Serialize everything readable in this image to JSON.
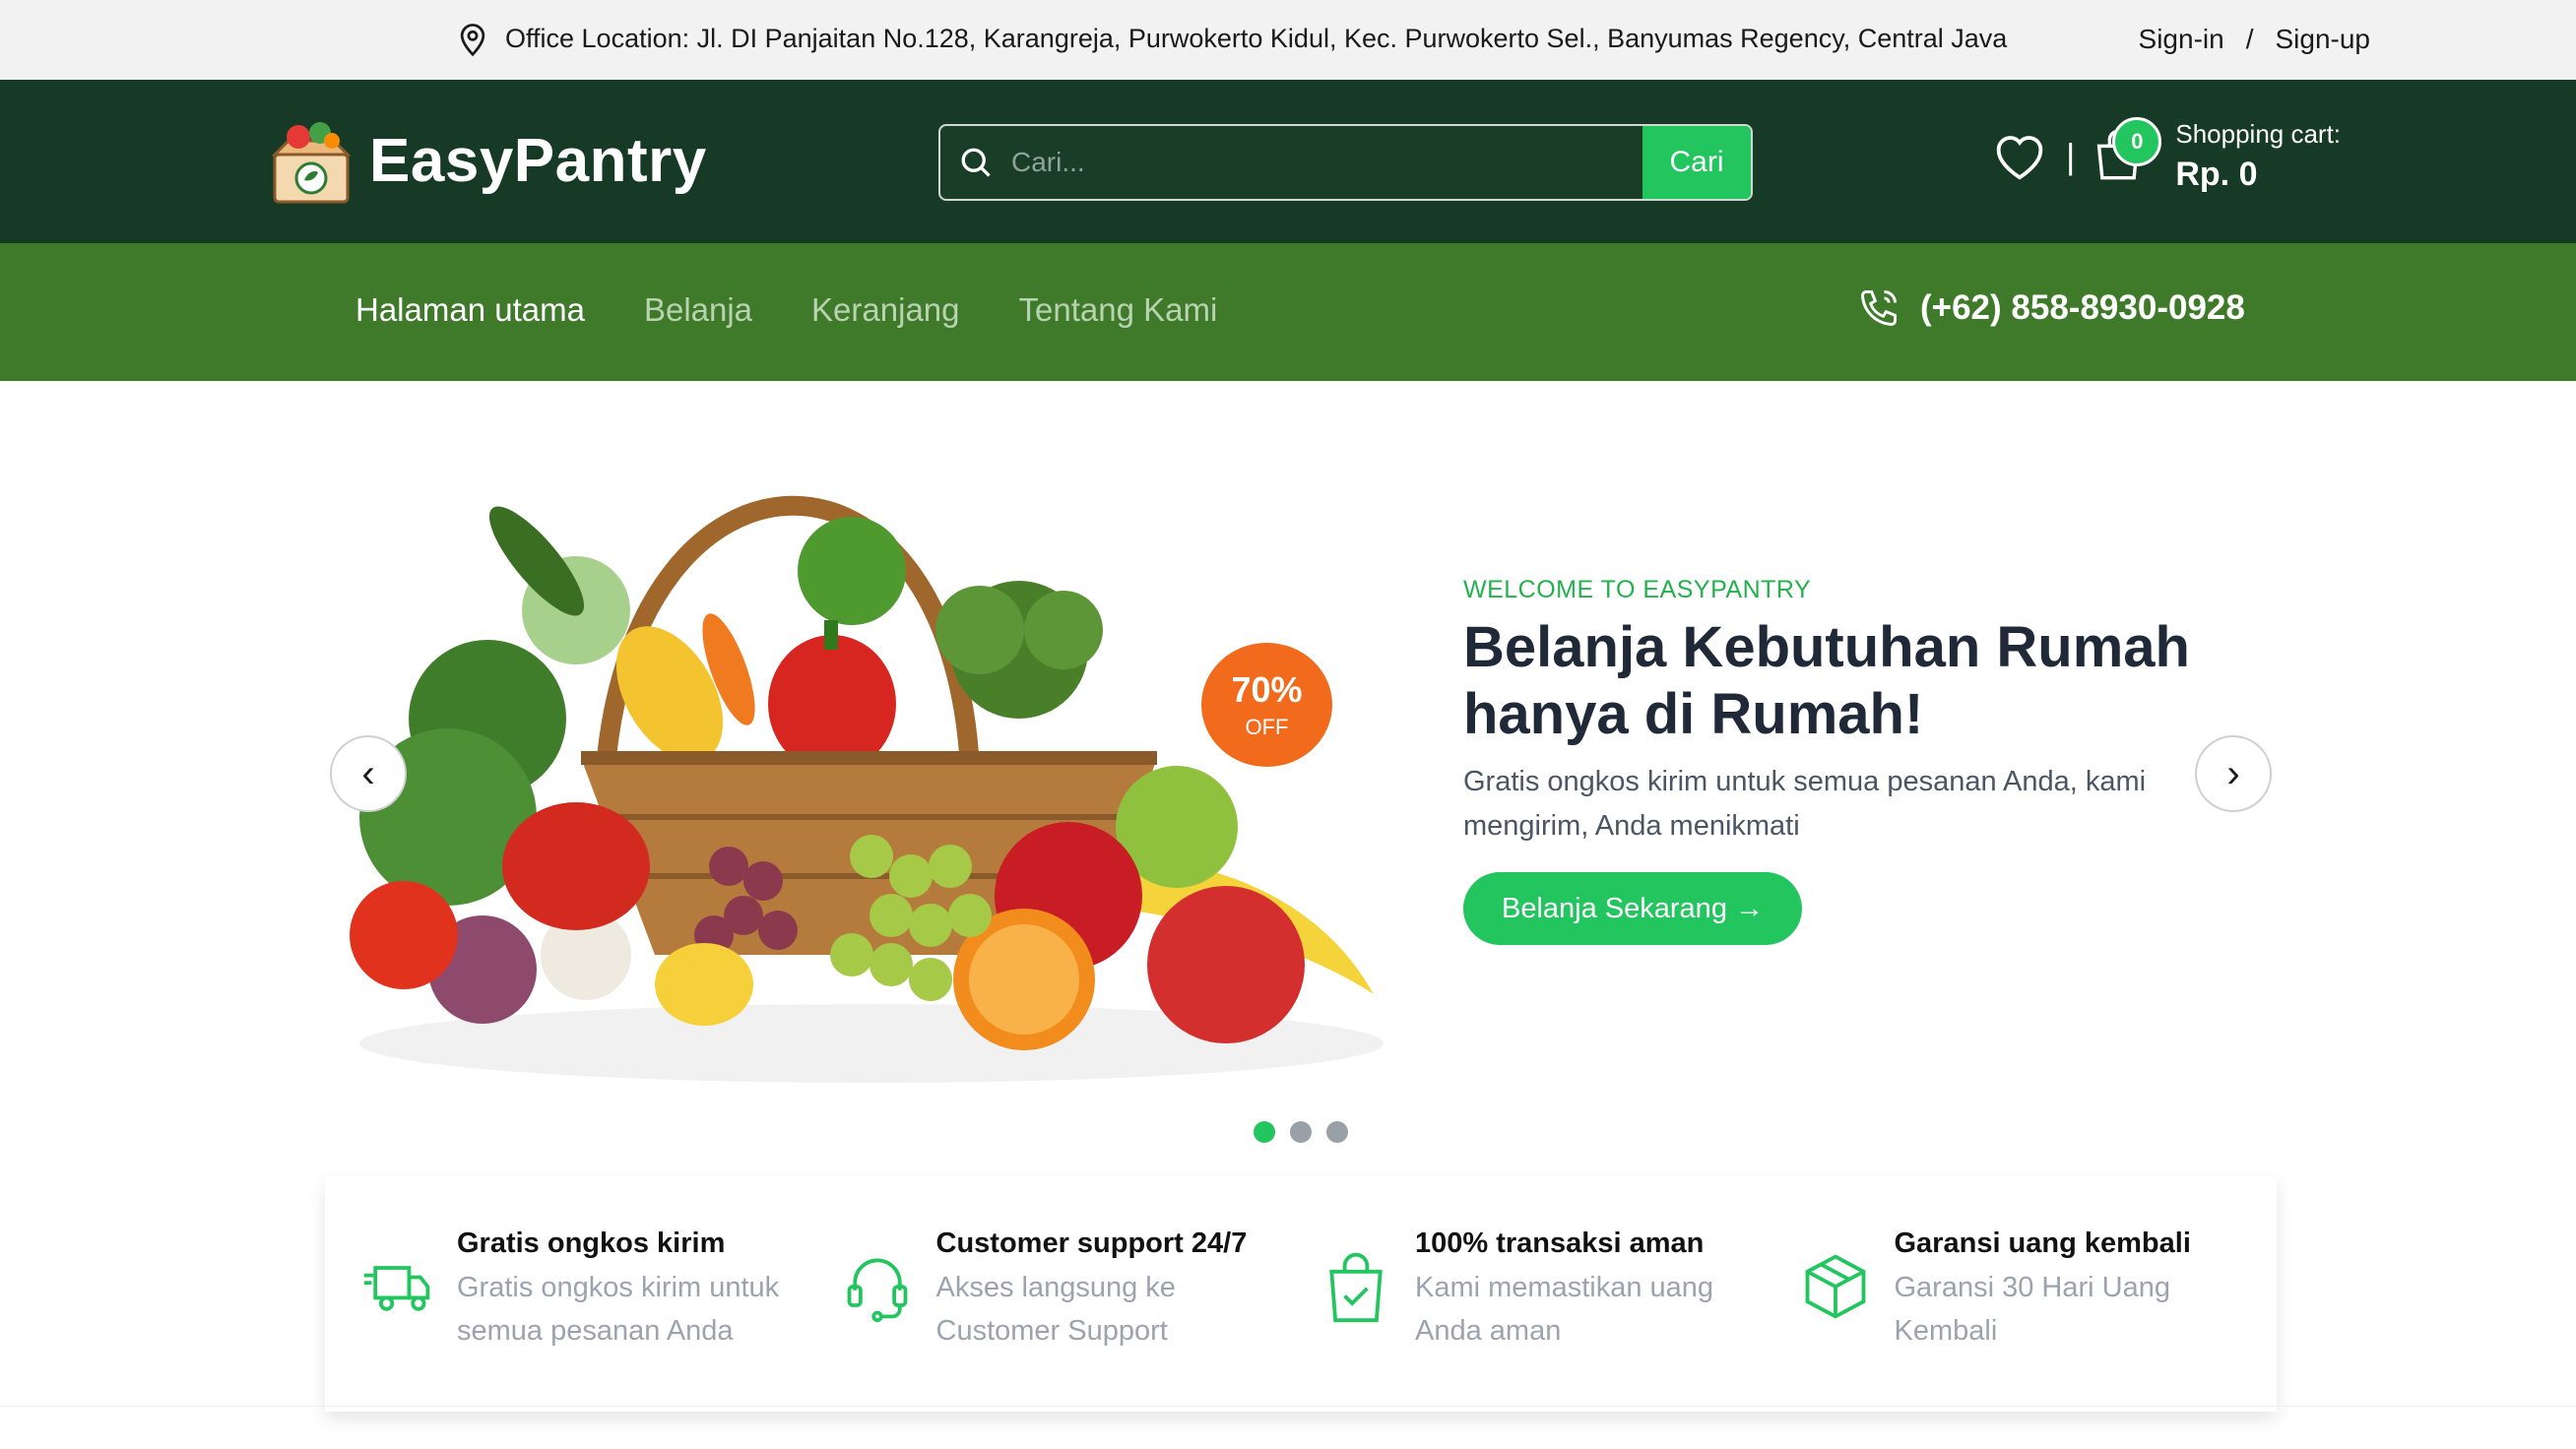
{
  "topbar": {
    "location": "Office Location: Jl. DI Panjaitan No.128, Karangreja, Purwokerto Kidul, Kec. Purwokerto Sel., Banyumas Regency, Central Java",
    "signin": "Sign-in",
    "divider": "/",
    "signup": "Sign-up"
  },
  "header": {
    "logo_text": "EasyPantry",
    "search_placeholder": "Cari...",
    "search_button": "Cari",
    "icon_divider": "|",
    "cart_count": "0",
    "cart_label": "Shopping cart:",
    "cart_total": "Rp. 0"
  },
  "nav": {
    "items": [
      {
        "label": "Halaman utama",
        "active": true
      },
      {
        "label": "Belanja",
        "active": false
      },
      {
        "label": "Keranjang",
        "active": false
      },
      {
        "label": "Tentang Kami",
        "active": false
      }
    ],
    "phone": "(+62) 858-8930-0928"
  },
  "hero": {
    "prev": "‹",
    "next": "›",
    "badge_value": "70%",
    "badge_label": "OFF",
    "welcome": "WELCOME TO EASYPANTRY",
    "title": "Belanja Kebutuhan Rumah hanya di Rumah!",
    "subtitle": "Gratis ongkos kirim untuk semua pesanan Anda, kami mengirim, Anda menikmati",
    "cta": "Belanja Sekarang →",
    "slides": 3,
    "active_slide": 1
  },
  "features": [
    {
      "icon": "truck-icon",
      "title": "Gratis ongkos kirim",
      "desc": "Gratis ongkos kirim untuk semua pesanan Anda"
    },
    {
      "icon": "headset-icon",
      "title": "Customer support 24/7",
      "desc": "Akses langsung ke Customer Support"
    },
    {
      "icon": "shopping-bag-check-icon",
      "title": "100% transaksi aman",
      "desc": "Kami memastikan uang Anda aman"
    },
    {
      "icon": "package-icon",
      "title": "Garansi uang kembali",
      "desc": "Garansi 30 Hari Uang Kembali"
    }
  ],
  "colors": {
    "accent": "#22c55e",
    "header_bg": "#163a25",
    "nav_bg": "#3f7a2b",
    "promo": "#f26a1b"
  }
}
